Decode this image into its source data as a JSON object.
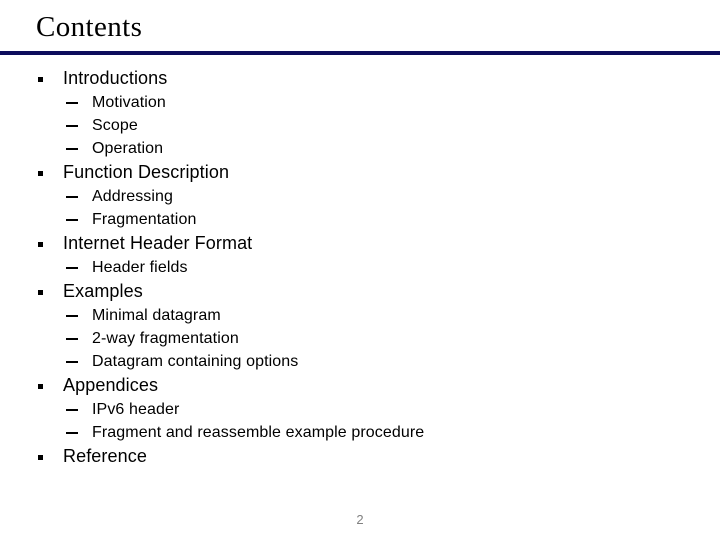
{
  "slide": {
    "title": "Contents",
    "rule_color": "#0d0d5c",
    "page_number": "2",
    "page_number_color": "#808080",
    "background_color": "#ffffff",
    "text_color": "#000000"
  },
  "outline": [
    {
      "level": 1,
      "label": "Introductions"
    },
    {
      "level": 2,
      "label": "Motivation"
    },
    {
      "level": 2,
      "label": "Scope"
    },
    {
      "level": 2,
      "label": "Operation"
    },
    {
      "level": 1,
      "label": "Function Description"
    },
    {
      "level": 2,
      "label": "Addressing"
    },
    {
      "level": 2,
      "label": "Fragmentation"
    },
    {
      "level": 1,
      "label": "Internet Header Format"
    },
    {
      "level": 2,
      "label": "Header fields"
    },
    {
      "level": 1,
      "label": "Examples"
    },
    {
      "level": 2,
      "label": "Minimal datagram"
    },
    {
      "level": 2,
      "label": "2-way fragmentation"
    },
    {
      "level": 2,
      "label": "Datagram containing options"
    },
    {
      "level": 1,
      "label": "Appendices"
    },
    {
      "level": 2,
      "label": "IPv6 header"
    },
    {
      "level": 2,
      "label": "Fragment and reassemble example procedure"
    },
    {
      "level": 1,
      "label": "Reference"
    }
  ]
}
